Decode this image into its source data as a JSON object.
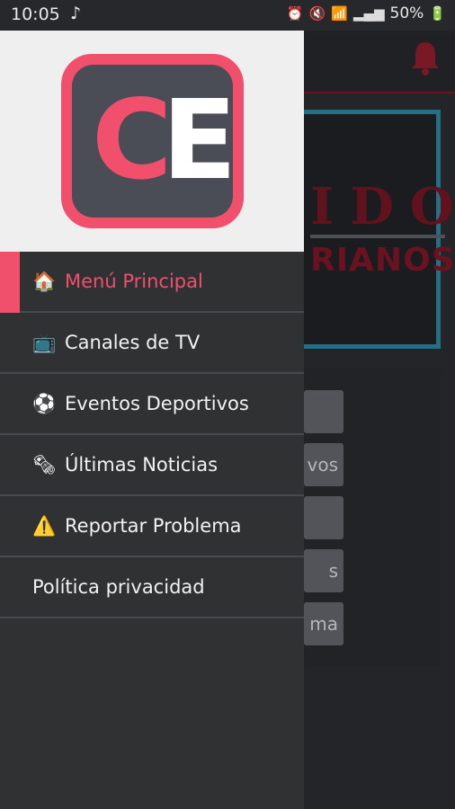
{
  "status_bar": {
    "time": "10:05",
    "music_glyph": "♪",
    "alarm_glyph": "⏰",
    "mute_glyph": "🔇",
    "wifi_glyph": "📶",
    "signal_glyph": "▂▄▆",
    "battery_text": "50%",
    "battery_glyph": "🔋"
  },
  "drawer": {
    "logo": {
      "letter1": "C",
      "letter2": "E"
    },
    "items": [
      {
        "icon": "🏠",
        "label": "Menú Principal",
        "active": true
      },
      {
        "icon": "📺",
        "label": "Canales de TV"
      },
      {
        "icon": "⚽",
        "label": "Eventos Deportivos"
      },
      {
        "icon": "🗞",
        "label": "Últimas Noticias"
      },
      {
        "icon": "⚠️",
        "label": "Reportar Problema"
      },
      {
        "icon": "",
        "label": "Política privacidad"
      }
    ]
  },
  "background": {
    "banner_title": "IDO",
    "banner_sub": "RIANOS",
    "buttons": [
      "",
      "vos",
      "",
      "s",
      "ma"
    ]
  },
  "colors": {
    "accent": "#f0506c",
    "drawer_bg": "#303133",
    "header_bg": "#efefef"
  }
}
